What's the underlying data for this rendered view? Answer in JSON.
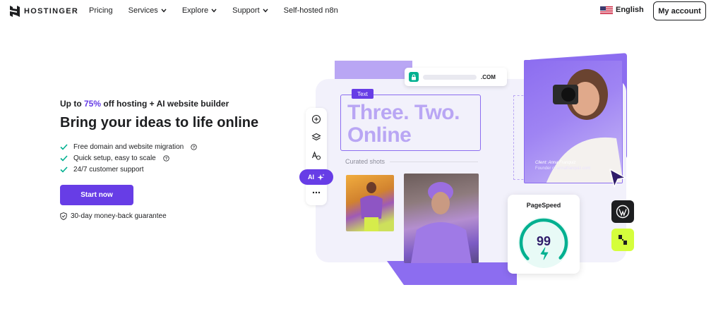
{
  "brand": {
    "name": "HOSTINGER",
    "accent": "#673de6"
  },
  "nav": {
    "links": [
      {
        "label": "Pricing",
        "has_dropdown": false
      },
      {
        "label": "Services",
        "has_dropdown": true
      },
      {
        "label": "Explore",
        "has_dropdown": true
      },
      {
        "label": "Support",
        "has_dropdown": true
      },
      {
        "label": "Self-hosted n8n",
        "has_dropdown": false
      }
    ],
    "language": "English",
    "account_button": "My account"
  },
  "hero": {
    "promo_prefix": "Up to ",
    "promo_accent": "75%",
    "promo_suffix": " off hosting + AI website builder",
    "headline": "Bring your ideas to life online",
    "features": [
      {
        "text": "Free domain and website migration",
        "has_help": true
      },
      {
        "text": "Quick setup, easy to scale",
        "has_help": true
      },
      {
        "text": "24/7 customer support",
        "has_help": false
      }
    ],
    "cta_label": "Start now",
    "guarantee": "30-day money-back guarantee"
  },
  "illustration": {
    "domain_suffix": ".COM",
    "text_tag": "Text",
    "big_text": "Three. Two. Online",
    "ai_label": "AI",
    "curated_label": "Curated shots",
    "caption_name": "Client: Anna Franquiz",
    "caption_role": "Founder of annafranquiz.com",
    "pagespeed_title": "PageSpeed",
    "pagespeed_score": "99",
    "pagespeed_fraction": 0.99,
    "colors": {
      "purple": "#673de6",
      "light_purple": "#b9a6f4",
      "green": "#00b090",
      "lime": "#d5fe3c"
    }
  }
}
